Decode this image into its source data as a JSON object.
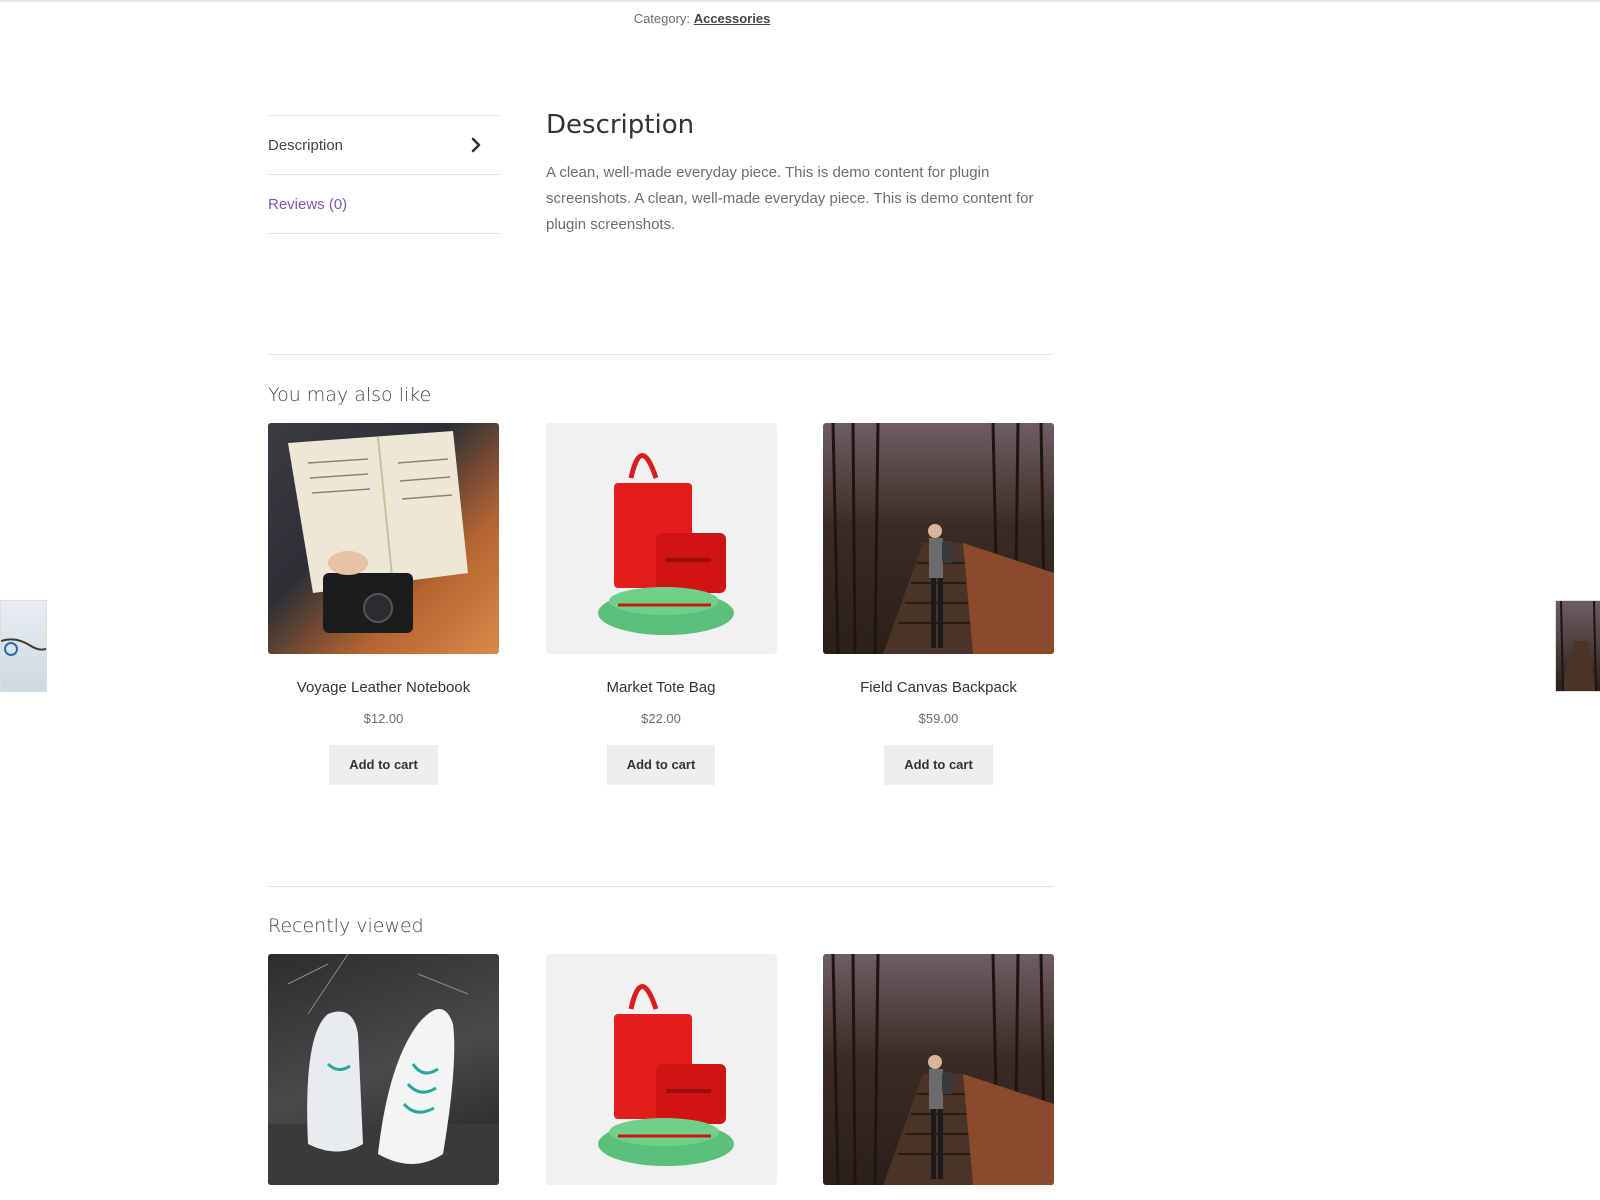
{
  "meta": {
    "category_label": "Category:",
    "category_link": "Accessories"
  },
  "tabs": [
    {
      "label": "Description"
    },
    {
      "label": "Reviews (0)"
    }
  ],
  "description": {
    "title": "Description",
    "text": "A clean, well-made everyday piece. This is demo content for plugin screenshots. A clean, well-made everyday piece. This is demo content for plugin screenshots."
  },
  "related": {
    "title": "You may also like",
    "products": [
      {
        "name": "Voyage Leather Notebook",
        "price": "$12.00",
        "button": "Add to cart"
      },
      {
        "name": "Market Tote Bag",
        "price": "$22.00",
        "button": "Add to cart"
      },
      {
        "name": "Field Canvas Backpack",
        "price": "$59.00",
        "button": "Add to cart"
      }
    ]
  },
  "recent": {
    "title": "Recently viewed"
  },
  "colors": {
    "accent": "#7f54b3",
    "button_bg": "#eeeeee"
  }
}
